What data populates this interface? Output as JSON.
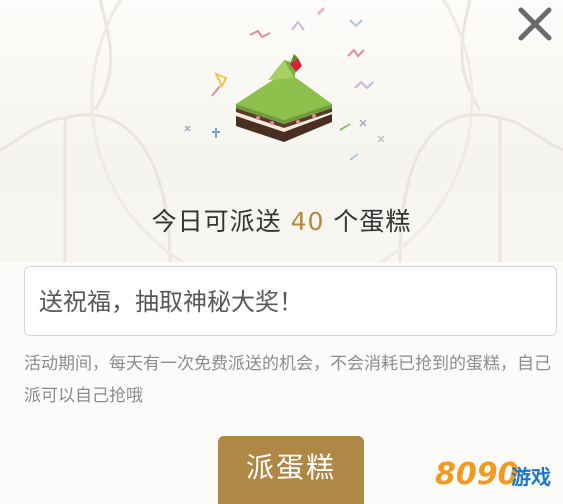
{
  "header": {
    "close_icon": "close-icon",
    "illustration": "cake-slice-icon"
  },
  "title": {
    "prefix": "今日可派送 ",
    "count": "40",
    "suffix": " 个蛋糕"
  },
  "message": {
    "placeholder": "送祝福，抽取神秘大奖！"
  },
  "notice": {
    "text": "活动期间，每天有一次免费派送的机会，不会消耗已抢到的蛋糕，自己派可以自己抢哦"
  },
  "action": {
    "send_label": "派蛋糕"
  },
  "watermark": {
    "brand_digits": "8090",
    "brand_text": "游戏"
  },
  "colors": {
    "accent": "#b08846",
    "count": "#b4893f",
    "cake_green": "#8dc04d",
    "cake_brown": "#4a2e22"
  }
}
